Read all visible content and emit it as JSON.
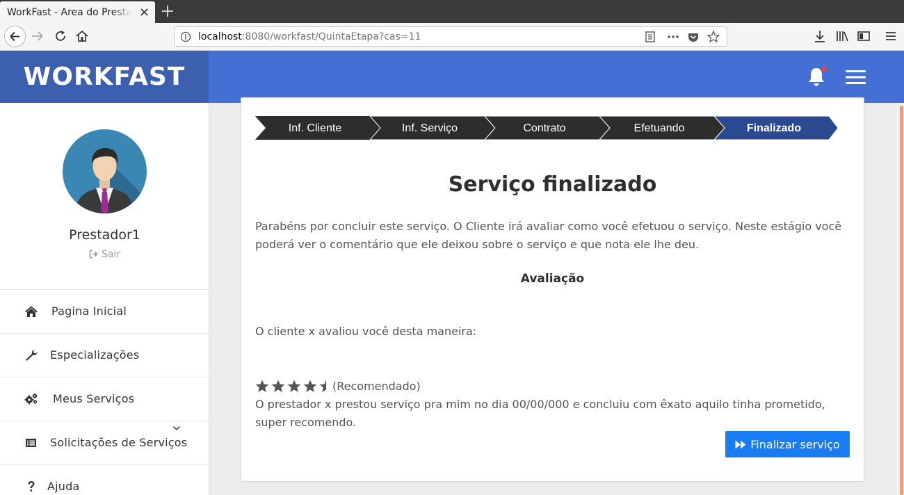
{
  "browser": {
    "tab_title": "WorkFast - Area do Prestador",
    "url_host": "localhost",
    "url_rest": ":8080/workfast/QuintaEtapa?cas=11"
  },
  "header": {
    "logo": "WORKFAST",
    "brand_color": "#4470d6",
    "logo_bg_color": "#3c5fb0"
  },
  "sidebar": {
    "username": "Prestador1",
    "logout_label": "Sair",
    "items": [
      {
        "label": "Pagina Inicial",
        "icon": "home-icon"
      },
      {
        "label": "Especializações",
        "icon": "wrench-icon"
      },
      {
        "label": "Meus Serviços",
        "icon": "cogs-icon"
      },
      {
        "label": "Solicitações de Serviços",
        "icon": "list-icon"
      },
      {
        "label": "Ajuda",
        "icon": "question-icon"
      }
    ]
  },
  "steps": [
    {
      "label": "Inf. Cliente",
      "active": false
    },
    {
      "label": "Inf. Serviço",
      "active": false
    },
    {
      "label": "Contrato",
      "active": false
    },
    {
      "label": "Efetuando",
      "active": false
    },
    {
      "label": "Finalizado",
      "active": true
    }
  ],
  "main": {
    "title": "Serviço finalizado",
    "intro": "Parabéns por concluir este serviço. O Cliente irá avaliar como você efetuou o serviço. Neste estágio você poderá ver o comentário que ele deixou sobre o serviço e que nota ele lhe deu.",
    "section_title": "Avaliação",
    "client_line": "O cliente x avaliou você desta maneira:",
    "rating_value": 4.5,
    "rating_max": 5,
    "rating_text": "(Recomendado)",
    "review": "O prestador x prestou serviço pra mim no dia 00/00/000 e concluiu com êxato aquilo tinha prometido, super recomendo.",
    "finish_button": "Finalizar serviço",
    "button_color": "#1a7cf2"
  }
}
